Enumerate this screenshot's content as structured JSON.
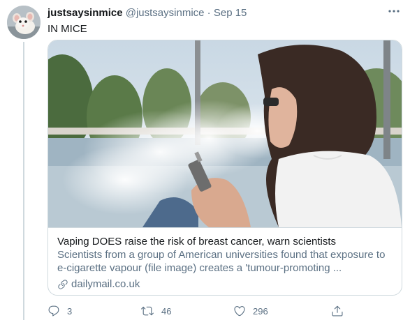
{
  "user": {
    "display_name": "justsaysinmice",
    "handle": "@justsaysinmice",
    "separator": "·",
    "date": "Sep 15"
  },
  "more_icon": "more-icon",
  "tweet_text": "IN MICE",
  "card": {
    "image_icon": "photo",
    "title": "Vaping DOES raise the risk of breast cancer, warn scientists",
    "description": "Scientists from a group of American universities found that exposure to e-cigarette vapour (file image) creates a 'tumour-promoting ...",
    "description_line1": "Scientists from a group of American universities found that exposure to",
    "description_line2": "e-cigarette vapour (file image) creates a 'tumour-promoting ...",
    "domain": "dailymail.co.uk"
  },
  "actions": {
    "replies": "3",
    "retweets": "46",
    "likes": "296"
  },
  "colors": {
    "text": "#14171a",
    "secondary": "#5b7083",
    "border": "#cfd9de"
  }
}
